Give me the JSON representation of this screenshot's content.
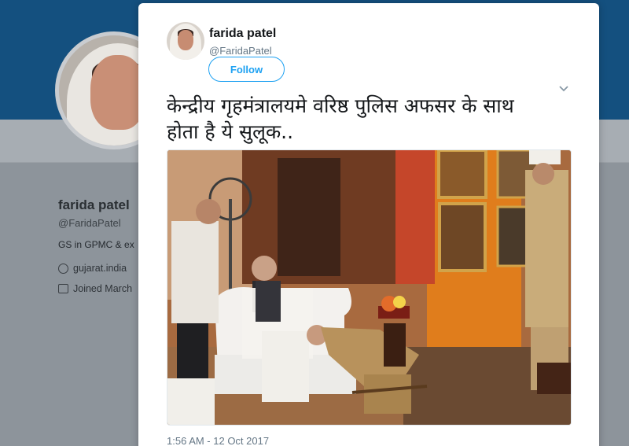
{
  "background": {
    "name": "farida patel",
    "handle": "@FaridaPatel",
    "bio": "GS in GPMC & ex",
    "website": "gujarat.india",
    "joined": "Joined March"
  },
  "tweet": {
    "author_name": "farida patel",
    "author_handle": "@FaridaPatel",
    "follow_label": "Follow",
    "text_line1": "केन्द्रीय गृहमंत्रालयमे वरिष्ठ पुलिस अफसर के साथ",
    "text_line2": "होता है ये सुलूक..",
    "timestamp": "1:56 AM - 12 Oct 2017"
  },
  "icons": {
    "location": "location-pin-icon",
    "calendar": "calendar-icon",
    "menu": "chevron-down-icon"
  },
  "colors": {
    "accent": "#1da1f2",
    "header": "#14507f"
  }
}
